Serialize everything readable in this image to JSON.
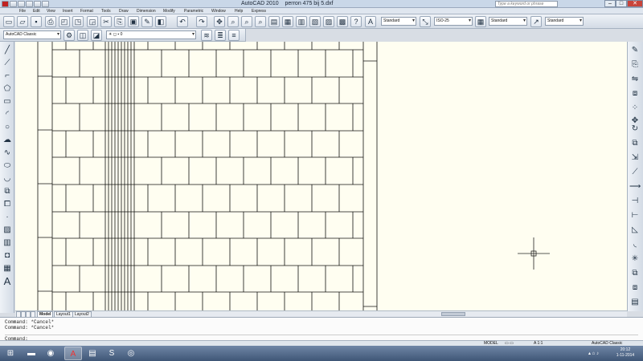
{
  "window": {
    "app_title": "AutoCAD 2010",
    "document_title": "perron 475 bij 5.dxf",
    "search_placeholder": "Type a keyword or phrase"
  },
  "menu": {
    "items": [
      "File",
      "Edit",
      "View",
      "Insert",
      "Format",
      "Tools",
      "Draw",
      "Dimension",
      "Modify",
      "Parametric",
      "Window",
      "Help",
      "Express"
    ]
  },
  "styles": {
    "text_style": "Standard",
    "dim_style": "ISO-25",
    "table_style": "Standard",
    "multileader_style": "Standard"
  },
  "workspace": {
    "name": "AutoCAD Classic",
    "layer": "0"
  },
  "layout_tabs": [
    "Model",
    "Layout1",
    "Layout2"
  ],
  "command_history": [
    "Command: *Cancel*",
    "Command: *Cancel*"
  ],
  "command_prompt": "Command:",
  "status": {
    "mode": "MODEL",
    "scale": "1:1",
    "workspace": "AutoCAD Classic"
  },
  "taskbar": {
    "time": "20:12",
    "date": "1-11-2014"
  },
  "icons": {
    "app": "autocad-logo-icon",
    "start": "windows-start-icon",
    "browser": "chrome-icon",
    "explorer": "file-explorer-icon",
    "skype": "skype-icon"
  },
  "colors": {
    "canvas_bg": "#fffef1",
    "title_bar": "#c9d7e8",
    "taskbar": "#4a6284"
  }
}
